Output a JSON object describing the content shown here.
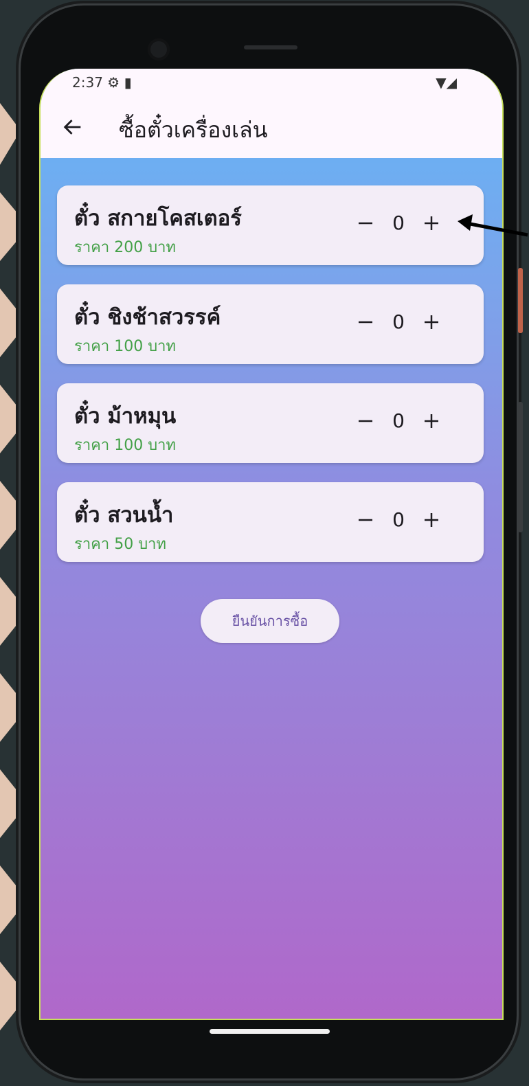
{
  "status": {
    "time": "2:37"
  },
  "appbar": {
    "title": "ซื้อตั๋วเครื่องเล่น"
  },
  "tickets": [
    {
      "name": "ตั๋ว สกายโคสเตอร์",
      "price": "ราคา 200 บาท",
      "qty": "0"
    },
    {
      "name": "ตั๋ว ชิงช้าสวรรค์",
      "price": "ราคา 100 บาท",
      "qty": "0"
    },
    {
      "name": "ตั๋ว ม้าหมุน",
      "price": "ราคา 100 บาท",
      "qty": "0"
    },
    {
      "name": "ตั๋ว สวนน้ำ",
      "price": "ราคา 50 บาท",
      "qty": "0"
    }
  ],
  "confirm_label": "ยืนยันการซื้อ",
  "icons": [
    "settings-icon",
    "sd-card-icon",
    "wifi-icon",
    "signal-icon",
    "back-arrow-icon",
    "minus-icon",
    "plus-icon"
  ],
  "colors": {
    "price": "#43a047",
    "accent": "#6750a4",
    "card": "#f3edf7"
  }
}
